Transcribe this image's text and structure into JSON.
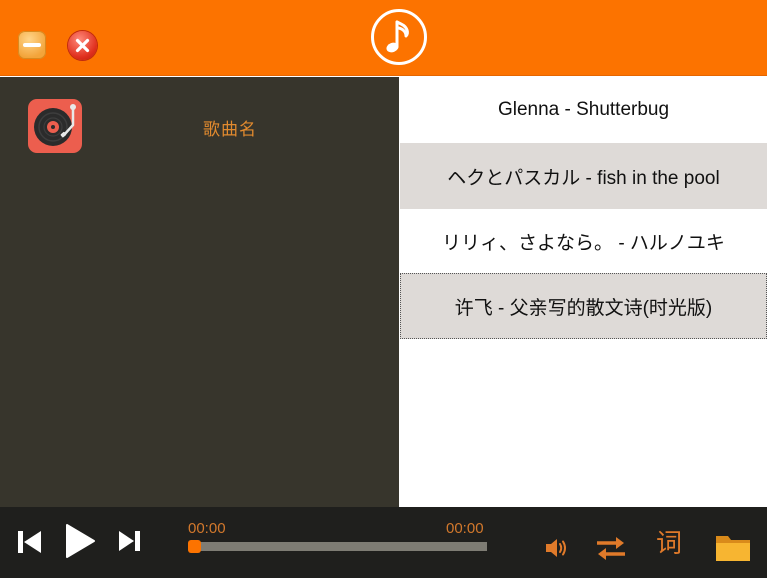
{
  "window": {
    "minimize_icon": "minimize-icon",
    "close_icon": "close-icon",
    "logo_icon": "music-note-icon",
    "accent_color": "#fc7300"
  },
  "now_playing": {
    "song_name": "歌曲名",
    "disc_icon": "record-player-icon"
  },
  "playlist": {
    "items": [
      {
        "label": "Glenna - Shutterbug"
      },
      {
        "label": "ヘクとパスカル - fish in the pool"
      },
      {
        "label": "リリィ、さよなら。 - ハルノユキ"
      },
      {
        "label": "许飞 - 父亲写的散文诗(时光版)"
      }
    ]
  },
  "controls": {
    "prev_icon": "skip-previous-icon",
    "play_icon": "play-icon",
    "next_icon": "skip-next-icon",
    "current_time": "00:00",
    "total_time": "00:00",
    "progress": 0,
    "volume_icon": "volume-icon",
    "loop_icon": "repeat-icon",
    "lyrics_label": "词",
    "folder_icon": "folder-icon"
  }
}
